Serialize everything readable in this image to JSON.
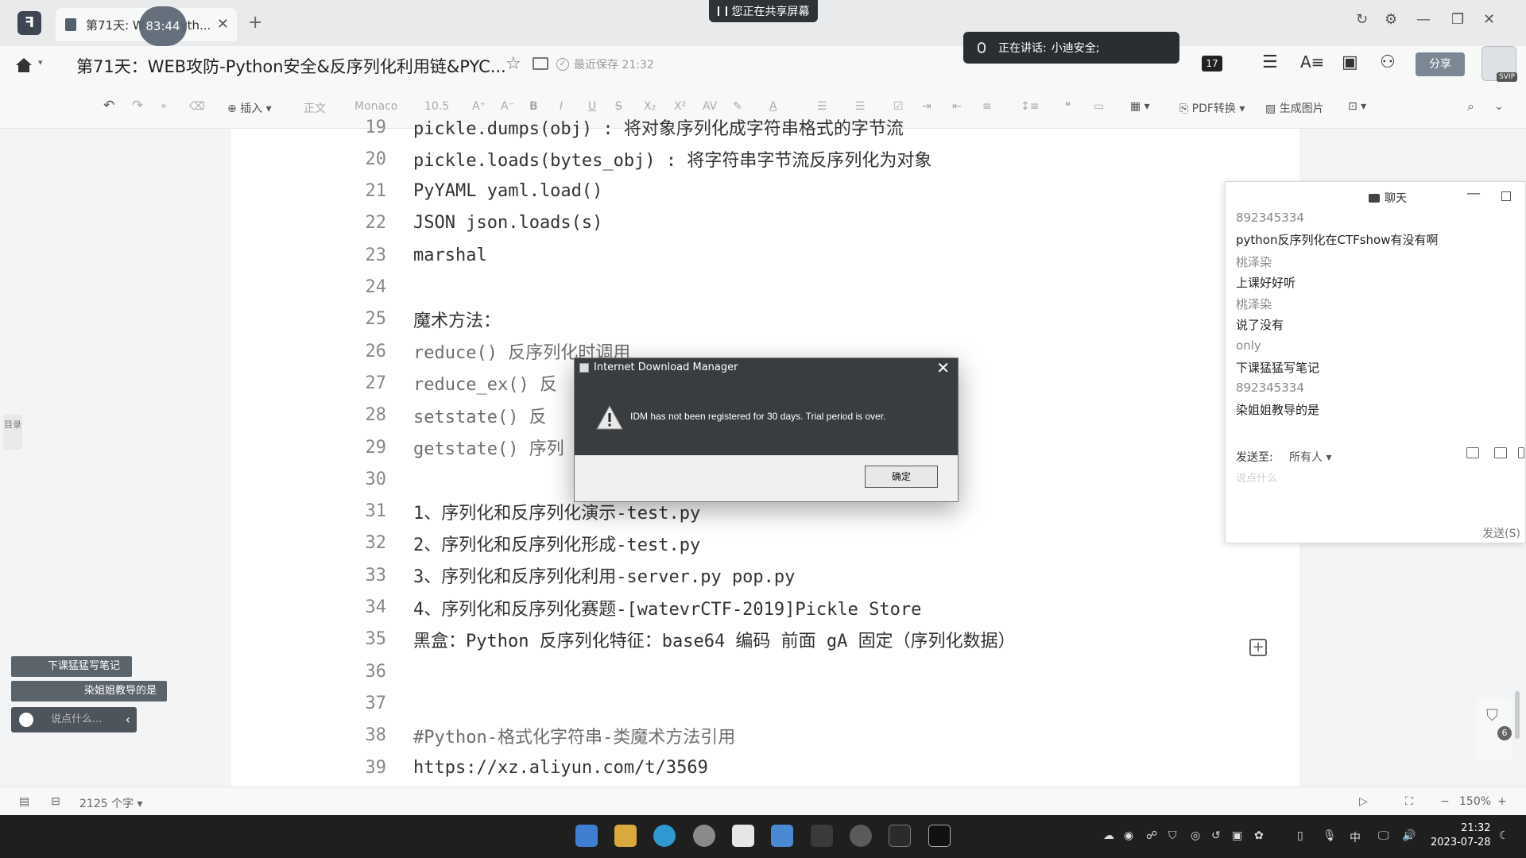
{
  "tabbar": {
    "tab_title": "第71天: W",
    "tab_title_suffix": "yth...",
    "timer": "83:44",
    "screen_share_banner": "您正在共享屏幕"
  },
  "titlebar": {
    "doc_title": "第71天：WEB攻防-Python安全&反序列化利用链&PYC...",
    "saved_status": "最近保存 21:32",
    "speaking_label": "正在讲话:",
    "speaking_name": "小迪安全;",
    "counter": "17",
    "share_label": "分享",
    "svip": "SVIP"
  },
  "toolbar": {
    "insert": "插入",
    "style": "正文",
    "font": "Monaco",
    "size": "10.5",
    "pdf": "PDF转换",
    "image": "生成图片"
  },
  "left_rail": "目录",
  "code_lines": [
    {
      "num": "19",
      "text": "pickle.dumps(obj) : 将对象序列化成字符串格式的字节流",
      "grey": false
    },
    {
      "num": "20",
      "text": "pickle.loads(bytes_obj) : 将字符串字节流反序列化为对象",
      "grey": false
    },
    {
      "num": "21",
      "text": "PyYAML yaml.load()",
      "grey": false
    },
    {
      "num": "22",
      "text": "JSON json.loads(s)",
      "grey": false
    },
    {
      "num": "23",
      "text": "marshal",
      "grey": false
    },
    {
      "num": "24",
      "text": "",
      "grey": false
    },
    {
      "num": "25",
      "text": "魔术方法：",
      "grey": false
    },
    {
      "num": "26",
      "text": "reduce() 反序列化时调用",
      "grey": true
    },
    {
      "num": "27",
      "text": "reduce_ex() 反",
      "grey": true
    },
    {
      "num": "28",
      "text": "setstate() 反",
      "grey": true
    },
    {
      "num": "29",
      "text": "getstate() 序列",
      "grey": true
    },
    {
      "num": "30",
      "text": "",
      "grey": false
    },
    {
      "num": "31",
      "text": "1、序列化和反序列化演示-test.py",
      "grey": false
    },
    {
      "num": "32",
      "text": "2、序列化和反序列化形成-test.py",
      "grey": false
    },
    {
      "num": "33",
      "text": "3、序列化和反序列化利用-server.py pop.py",
      "grey": false
    },
    {
      "num": "34",
      "text": "4、序列化和反序列化赛题-[watevrCTF-2019]Pickle Store",
      "grey": false
    },
    {
      "num": "35",
      "text": "黑盒：Python 反序列化特征：base64 编码 前面 gA 固定（序列化数据）",
      "grey": false
    },
    {
      "num": "36",
      "text": "",
      "grey": false
    },
    {
      "num": "37",
      "text": "",
      "grey": false
    },
    {
      "num": "38",
      "text": "#Python-格式化字符串-类魔术方法引用",
      "grey": true
    },
    {
      "num": "39",
      "text": "https://xz.aliyun.com/t/3569",
      "grey": false
    }
  ],
  "dialog": {
    "title": "Internet Download Manager",
    "message": "IDM has not been registered for 30 days. Trial period is over.",
    "ok_label": "确定"
  },
  "chat": {
    "title": "聊天",
    "messages": [
      {
        "sender": "892345334",
        "text": "python反序列化在CTFshow有没有啊"
      },
      {
        "sender": "桃泽染",
        "text": "上课好好听"
      },
      {
        "sender": "桃泽染",
        "text": "说了没有"
      },
      {
        "sender": "only",
        "text": "下课猛猛写笔记"
      },
      {
        "sender": "892345334",
        "text": "染姐姐教导的是"
      }
    ],
    "send_to_label": "发送至:",
    "send_to_value": "所有人",
    "input_placeholder": "说点什么",
    "send_label": "发送(S)"
  },
  "danmaku": {
    "msg1": "下课猛猛写笔记",
    "msg2": "染姐姐教导的是",
    "say_placeholder": "说点什么..."
  },
  "statusbar": {
    "word_count": "2125 个字",
    "zoom": "150%"
  },
  "taskbar": {
    "ime": "中",
    "time": "21:32",
    "date": "2023-07-28"
  },
  "colors": {
    "dialog_bg": "#3a3d40",
    "share_button": "#7c8794",
    "taskbar": "#1f1f1f"
  }
}
